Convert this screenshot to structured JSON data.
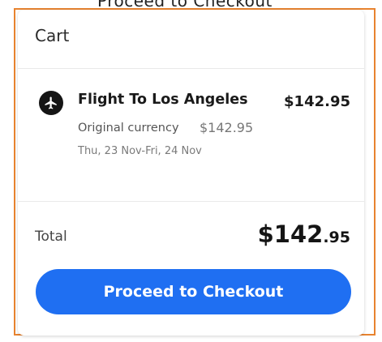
{
  "top_clipped_text": "Proceed to Checkout",
  "cart": {
    "title": "Cart",
    "item": {
      "icon": "airplane-icon",
      "title": "Flight To Los Angeles",
      "price": "$142.95",
      "original_currency_label": "Original currency",
      "original_currency_value": "$142.95",
      "dates": "Thu, 23 Nov-Fri, 24 Nov"
    },
    "total": {
      "label": "Total",
      "amount_main": "$142",
      "amount_cents": ".95"
    },
    "checkout_label": "Proceed to Checkout"
  },
  "colors": {
    "frame_border": "#e8832f",
    "button_blue": "#1f6ff2",
    "icon_black": "#151515"
  }
}
